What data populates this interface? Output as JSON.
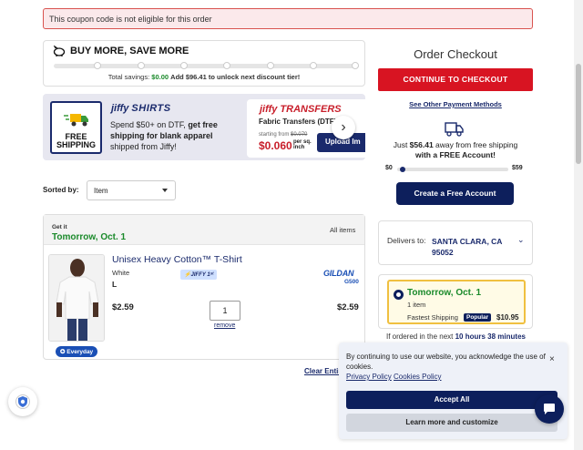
{
  "alert": {
    "message": "This coupon code is not eligible for this order"
  },
  "buy_more": {
    "title": "BUY MORE, SAVE MORE",
    "total_savings_label": "Total savings:",
    "total_savings_value": "$0.00",
    "unlock_text": "Add $96.41 to unlock next discount tier!"
  },
  "promo": {
    "shirts_logo_brand": "jiffy",
    "shirts_logo_word": "SHIRTS",
    "free_shipping_label": "FREE SHIPPING",
    "shirts_text_a": "Spend $50+ on DTF, ",
    "shirts_text_b": "get free shipping for blank apparel",
    "shirts_text_c": " shipped from Jiffy!",
    "transfers_logo_brand": "jiffy",
    "transfers_logo_word": "TRANSFERS",
    "transfers_sub": "Fabric Transfers (DTF)",
    "starting_from": "starting from",
    "old_price": "$0.070",
    "new_price": "$0.060",
    "per_unit": "per sq. inch",
    "upload_label": "Upload Im"
  },
  "sort": {
    "label": "Sorted by:",
    "value": "Item"
  },
  "items": {
    "get_it": "Get it",
    "delivery": "Tomorrow, Oct. 1",
    "all_items": "All items",
    "product": {
      "name": "Unisex Heavy Cotton™ T-Shirt",
      "color": "White",
      "size": "L",
      "badge": "JIFFY 1ˢᵗ",
      "brand": "GILDAN",
      "model": "G500",
      "unit_price": "$2.59",
      "quantity": "1",
      "remove": "remove",
      "total": "$2.59",
      "everyday": "Everyday"
    },
    "clear": "Clear Entire"
  },
  "checkout": {
    "title": "Order Checkout",
    "continue": "CONTINUE TO CHECKOUT",
    "other_payment": "See Other Payment Methods",
    "away_a": "Just ",
    "away_amount": "$56.41",
    "away_b": " away from free shipping",
    "away_c": "with a FREE Account!",
    "free_ship_progress": 0.049,
    "range_min": "$0",
    "range_max": "$59",
    "create_account": "Create a Free Account",
    "delivers_to_label": "Delivers to:",
    "delivers_to_value": "SANTA CLARA, CA 95052",
    "ship_day": "Tomorrow, Oct. 1",
    "ship_items": "1 item",
    "ship_method": "Fastest Shipping",
    "ship_popular": "Popular",
    "ship_price": "$10.95",
    "ordered_prefix": "If ordered in the next ",
    "ordered_time": "10 hours 38 minutes"
  },
  "cookie": {
    "text": "By continuing to use our website, you acknowledge the use of cookies.",
    "privacy": "Privacy Policy",
    "cookies": "Cookies Policy",
    "close": "×",
    "accept": "Accept All",
    "learn": "Learn more and customize"
  },
  "colors": {
    "brand_navy": "#0d1f5c",
    "brand_red": "#d81422",
    "green": "#1a8a2a"
  }
}
